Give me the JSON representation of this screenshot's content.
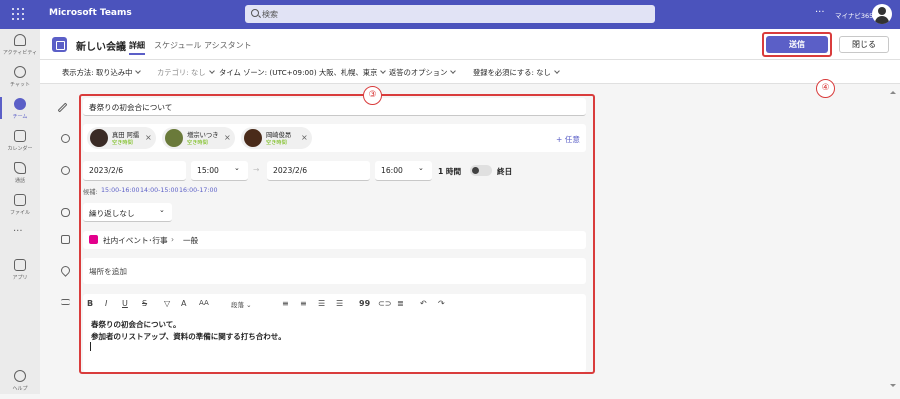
{
  "topbar": {
    "app_title": "Microsoft Teams",
    "search_placeholder": "検索",
    "more": "···",
    "org_name": "マイナビ365"
  },
  "rail": {
    "items": [
      {
        "label": "アクティビティ",
        "icon": "bell-icon"
      },
      {
        "label": "チャット",
        "icon": "chat-icon"
      },
      {
        "label": "チーム",
        "icon": "teams-icon",
        "active": true
      },
      {
        "label": "カレンダー",
        "icon": "calendar-icon"
      },
      {
        "label": "通話",
        "icon": "phone-icon"
      },
      {
        "label": "ファイル",
        "icon": "file-icon"
      },
      {
        "label": "アプリ",
        "icon": "apps-icon"
      },
      {
        "label": "ヘルプ",
        "icon": "help-icon"
      }
    ],
    "more": "···"
  },
  "header": {
    "title": "新しい会議",
    "tab_details": "詳細",
    "tab_assistant": "スケジュール アシスタント",
    "send": "送信",
    "close": "閉じる"
  },
  "options": {
    "view": "表示方法: 取り込み中",
    "category": "カテゴリ: なし",
    "timezone": "タイム ゾーン: (UTC+09:00) 大阪、札幌、東京",
    "reply": "返答のオプション",
    "required": "登録を必須にする: なし"
  },
  "form": {
    "meeting_title": "春祭りの初会合について",
    "attendees": [
      {
        "name": "真田 阿擂",
        "status": "空き時間"
      },
      {
        "name": "増宗いつき",
        "status": "空き時間"
      },
      {
        "name": "岡崎俊昂",
        "status": "空き時間"
      }
    ],
    "optional": "+ 任意",
    "start_date": "2023/2/6",
    "start_time": "15:00",
    "end_date": "2023/2/6",
    "end_time": "16:00",
    "duration": "1 時間",
    "all_day": "終日",
    "suggestions_label": "候補:",
    "suggestions": [
      "15:00-16:00",
      "14:00-15:00",
      "16:00-17:00"
    ],
    "repeat": "繰り返しなし",
    "channel": "社内イベント･行事",
    "channel_sub": "一般",
    "location_placeholder": "場所を追加",
    "paragraph_style": "段落",
    "body_line1": "春祭りの初会合について。",
    "body_line2": "参加者のリストアップ、資料の準備に関する打ち合わせ。"
  },
  "annotations": {
    "badge3": "③",
    "badge4": "④"
  },
  "colors": {
    "brand": "#5b5fc7",
    "topbar": "#4b53bc",
    "highlight": "#d93c3c",
    "status": "#6bb700"
  }
}
